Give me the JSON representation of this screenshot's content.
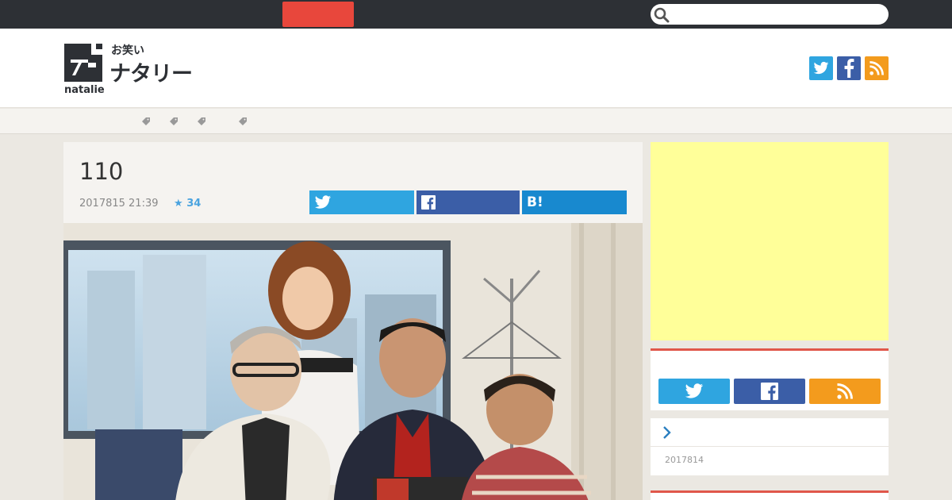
{
  "topbar": {
    "search": {
      "value": "",
      "placeholder": ""
    }
  },
  "header": {
    "logo": {
      "sub": "お笑い",
      "main": "ナタリー",
      "en": "natalie"
    }
  },
  "tags": [
    {
      "label": ""
    },
    {
      "label": ""
    },
    {
      "label": ""
    },
    {
      "label": ""
    }
  ],
  "article": {
    "title": "110",
    "date": "2017815 21:39",
    "favorites": "34",
    "share": {
      "hatena_label": "B!"
    }
  },
  "sidebar": {
    "related": {
      "date": "2017814"
    }
  },
  "colors": {
    "topbar": "#2d3035",
    "accent_red": "#e8473c",
    "twitter": "#2fa5e0",
    "facebook": "#3b5ea7",
    "rss": "#f39b1d",
    "hatena": "#1889cf",
    "ad": "#ffff99"
  }
}
